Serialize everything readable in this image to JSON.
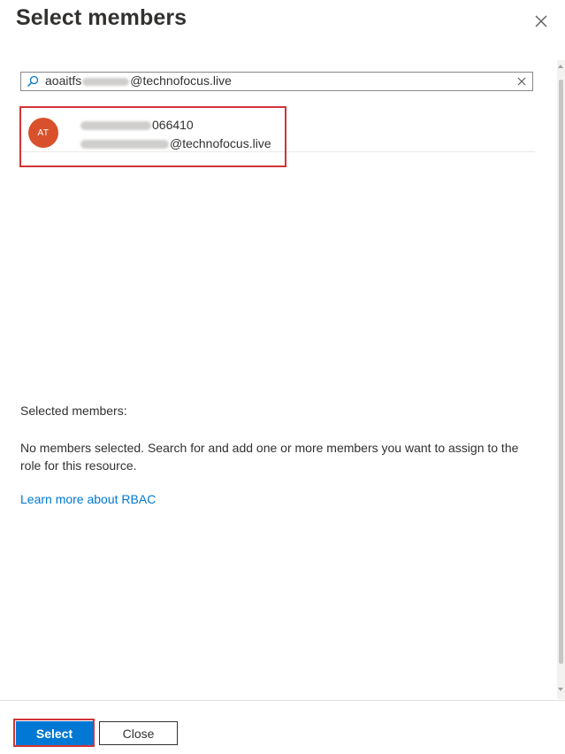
{
  "panel": {
    "title": "Select members"
  },
  "search": {
    "value_prefix": "aoaitfs",
    "value_suffix": "@technofocus.live",
    "placeholder": ""
  },
  "result": {
    "avatar_initials": "AT",
    "name_visible": "6410",
    "name_visible_prefix": "06",
    "email_visible": "@technofocus.live"
  },
  "selected": {
    "label": "Selected members:",
    "empty_message": "No members selected. Search for and add one or more members you want to assign to the role for this resource.",
    "learn_link": "Learn more about RBAC"
  },
  "footer": {
    "select_label": "Select",
    "close_label": "Close"
  },
  "colors": {
    "primary": "#0078d4",
    "highlight": "#d13438",
    "avatar": "#d9512c"
  },
  "icons": {
    "close": "close-icon",
    "search": "search-icon",
    "clear": "clear-icon"
  }
}
